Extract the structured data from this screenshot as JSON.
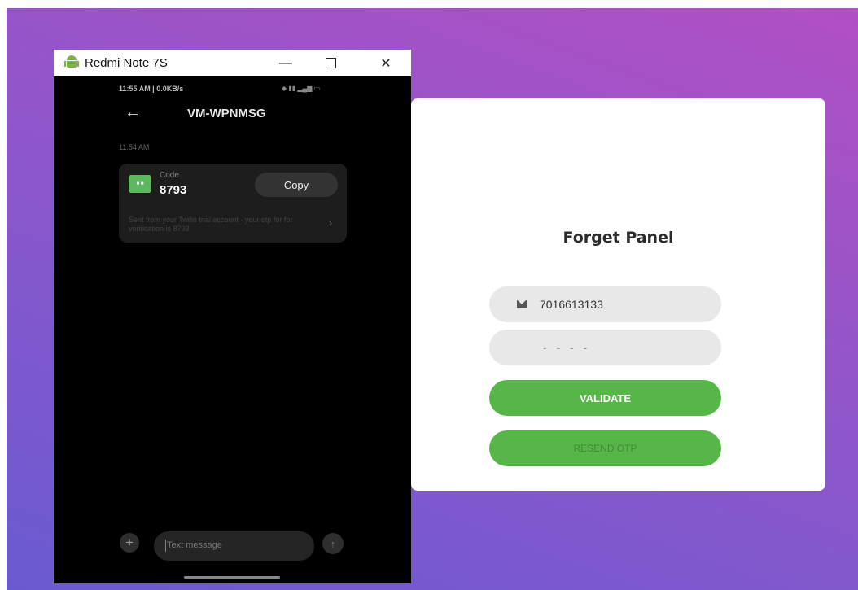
{
  "window": {
    "title": "Redmi Note 7S",
    "min_glyph": "—",
    "close_glyph": "✕"
  },
  "phone": {
    "status_time": "11:55 AM | 0.0KB/s",
    "status_icons": "◆ ▮▮ ▂▄▆ ▭",
    "back_glyph": "←",
    "sender": "VM-WPNMSG",
    "timestamp": "11:54 AM",
    "code_label": "Code",
    "code_value": "8793",
    "copy_label": "Copy",
    "message": "Sent from your Twilio trial account - your otp for for verification is 8793",
    "chevron": "›",
    "compose_placeholder": "Text message",
    "plus_glyph": "+",
    "send_glyph": "↑"
  },
  "panel": {
    "title": "Forget Panel",
    "phone_value": "7016613133",
    "otp_placeholder": "- - - -",
    "validate_label": "VALIDATE",
    "resend_label": "RESEND OTP"
  },
  "colors": {
    "accent": "#57b648",
    "bg_start": "#6a5ad1",
    "bg_end": "#b14fc4"
  },
  "icons": [
    "android-icon",
    "mail-icon",
    "back-arrow-icon",
    "chevron-right-icon",
    "plus-icon",
    "send-icon"
  ]
}
